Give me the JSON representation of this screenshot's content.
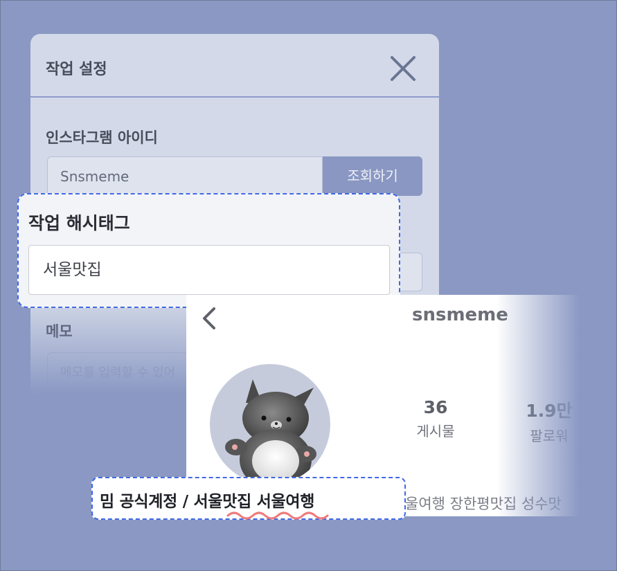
{
  "settings_modal": {
    "title": "작업 설정",
    "instagram_id_label": "인스타그램 아이디",
    "instagram_id_value": "Snsmeme",
    "lookup_button": "조회하기",
    "memo_label": "메모",
    "memo_placeholder": "메모를 입력할 수 있어"
  },
  "hashtag": {
    "label": "작업 해시태그",
    "value": "서울맛집"
  },
  "profile": {
    "username": "snsmeme",
    "posts_count": "36",
    "posts_label": "게시물",
    "followers_count": "1.9만",
    "followers_label": "팔로워",
    "bio_overflow": "울여행 장한평맛집 성수맛",
    "bio_highlight": "밈 공식계정 / 서울맛집 서울여행"
  },
  "colors": {
    "background": "#8a98c3",
    "accent_dashed": "#3f68e6",
    "lookup_button": "#8a97c2",
    "squiggle": "#f07a7a"
  },
  "icons": {
    "close": "close-icon",
    "back": "back-arrow-icon",
    "avatar": "cat-plush-icon"
  }
}
